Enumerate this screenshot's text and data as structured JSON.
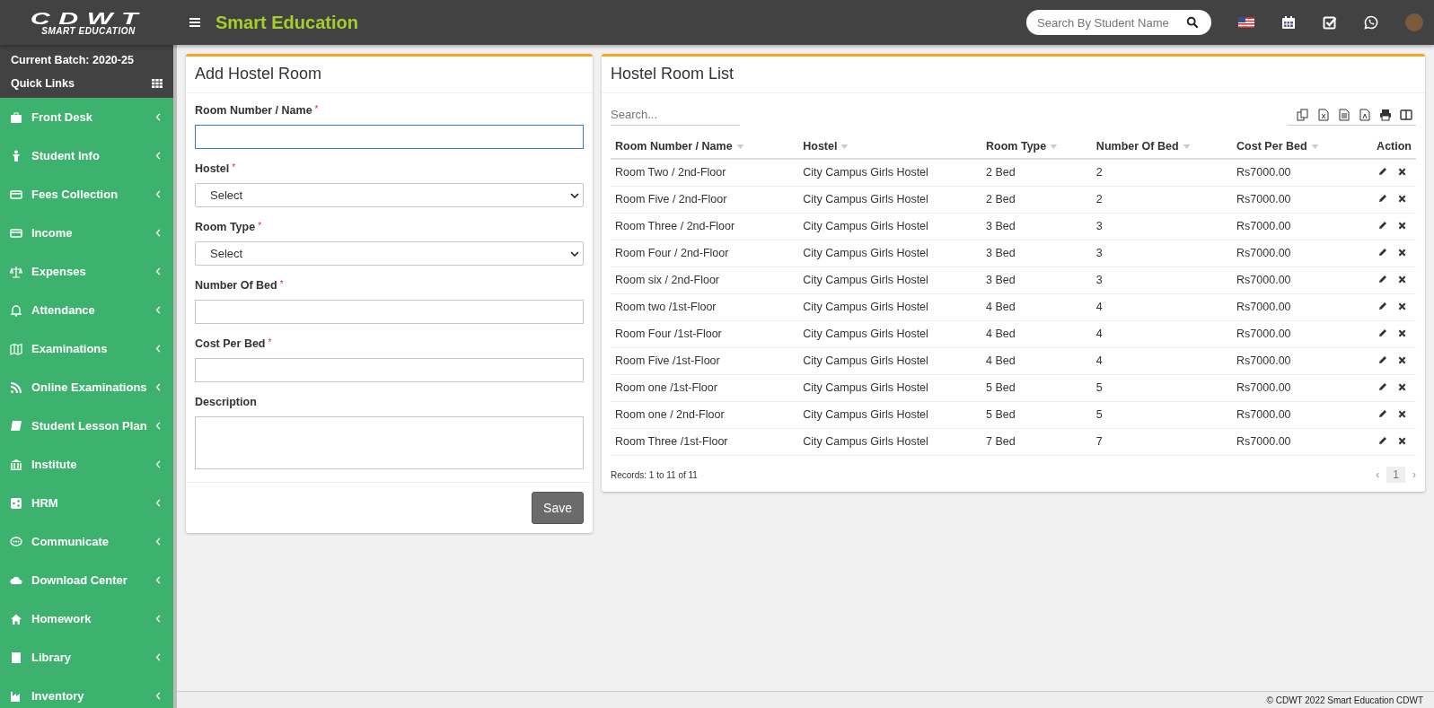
{
  "header": {
    "logo_title": "CDWT",
    "logo_subtitle": "SMART EDUCATION",
    "app_title": "Smart Education",
    "search": {
      "placeholder": "Search By Student Name"
    }
  },
  "sidebar": {
    "batch": "Current Batch: 2020-25",
    "quick_links": "Quick Links",
    "items": [
      {
        "label": "Front Desk"
      },
      {
        "label": "Student Info"
      },
      {
        "label": "Fees Collection"
      },
      {
        "label": "Income"
      },
      {
        "label": "Expenses"
      },
      {
        "label": "Attendance"
      },
      {
        "label": "Examinations"
      },
      {
        "label": "Online Examinations"
      },
      {
        "label": "Student Lesson Plan"
      },
      {
        "label": "Institute"
      },
      {
        "label": "HRM"
      },
      {
        "label": "Communicate"
      },
      {
        "label": "Download Center"
      },
      {
        "label": "Homework"
      },
      {
        "label": "Library"
      },
      {
        "label": "Inventory"
      }
    ]
  },
  "form": {
    "title": "Add Hostel Room",
    "fields": [
      {
        "label": "Room Number / Name",
        "required_mark": "*",
        "kind": "text",
        "focused": true
      },
      {
        "label": "Hostel",
        "required_mark": "*",
        "kind": "select",
        "value": "Select",
        "focused": false
      },
      {
        "label": "Room Type",
        "required_mark": "*",
        "kind": "select",
        "value": "Select",
        "focused": false
      },
      {
        "label": "Number Of Bed",
        "required_mark": "*",
        "kind": "text",
        "focused": false
      },
      {
        "label": "Cost Per Bed",
        "required_mark": "*",
        "kind": "text",
        "focused": false
      },
      {
        "label": "Description",
        "kind": "textarea",
        "focused": false
      }
    ],
    "save_button": "Save"
  },
  "list": {
    "title": "Hostel Room List",
    "search": {
      "placeholder": "Search..."
    },
    "columns": [
      {
        "label": "Room Number / Name",
        "sortable": true
      },
      {
        "label": "Hostel",
        "sortable": true
      },
      {
        "label": "Room Type",
        "sortable": true
      },
      {
        "label": "Number Of Bed",
        "sortable": true
      },
      {
        "label": "Cost Per Bed",
        "sortable": true
      },
      {
        "label": "Action",
        "sortable": false
      }
    ],
    "rows": [
      [
        "Room Two / 2nd-Floor",
        "City Campus Girls Hostel",
        "2 Bed",
        "2",
        "Rs7000.00"
      ],
      [
        "Room Five / 2nd-Floor",
        "City Campus Girls Hostel",
        "2 Bed",
        "2",
        "Rs7000.00"
      ],
      [
        "Room Three / 2nd-Floor",
        "City Campus Girls Hostel",
        "3 Bed",
        "3",
        "Rs7000.00"
      ],
      [
        "Room Four / 2nd-Floor",
        "City Campus Girls Hostel",
        "3 Bed",
        "3",
        "Rs7000.00"
      ],
      [
        "Room six / 2nd-Floor",
        "City Campus Girls Hostel",
        "3 Bed",
        "3",
        "Rs7000.00"
      ],
      [
        "Room two /1st-Floor",
        "City Campus Girls Hostel",
        "4 Bed",
        "4",
        "Rs7000.00"
      ],
      [
        "Room Four /1st-Floor",
        "City Campus Girls Hostel",
        "4 Bed",
        "4",
        "Rs7000.00"
      ],
      [
        "Room Five /1st-Floor",
        "City Campus Girls Hostel",
        "4 Bed",
        "4",
        "Rs7000.00"
      ],
      [
        "Room one /1st-Floor",
        "City Campus Girls Hostel",
        "5 Bed",
        "5",
        "Rs7000.00"
      ],
      [
        "Room one / 2nd-Floor",
        "City Campus Girls Hostel",
        "5 Bed",
        "5",
        "Rs7000.00"
      ],
      [
        "Room Three /1st-Floor",
        "City Campus Girls Hostel",
        "7 Bed",
        "7",
        "Rs7000.00"
      ]
    ],
    "records": "Records: 1 to 11 of 11",
    "pagination": {
      "prev": "‹",
      "next": "›",
      "pages": [
        {
          "label": "1",
          "selected": true
        }
      ]
    }
  },
  "footer": "© CDWT 2022 Smart Education CDWT"
}
